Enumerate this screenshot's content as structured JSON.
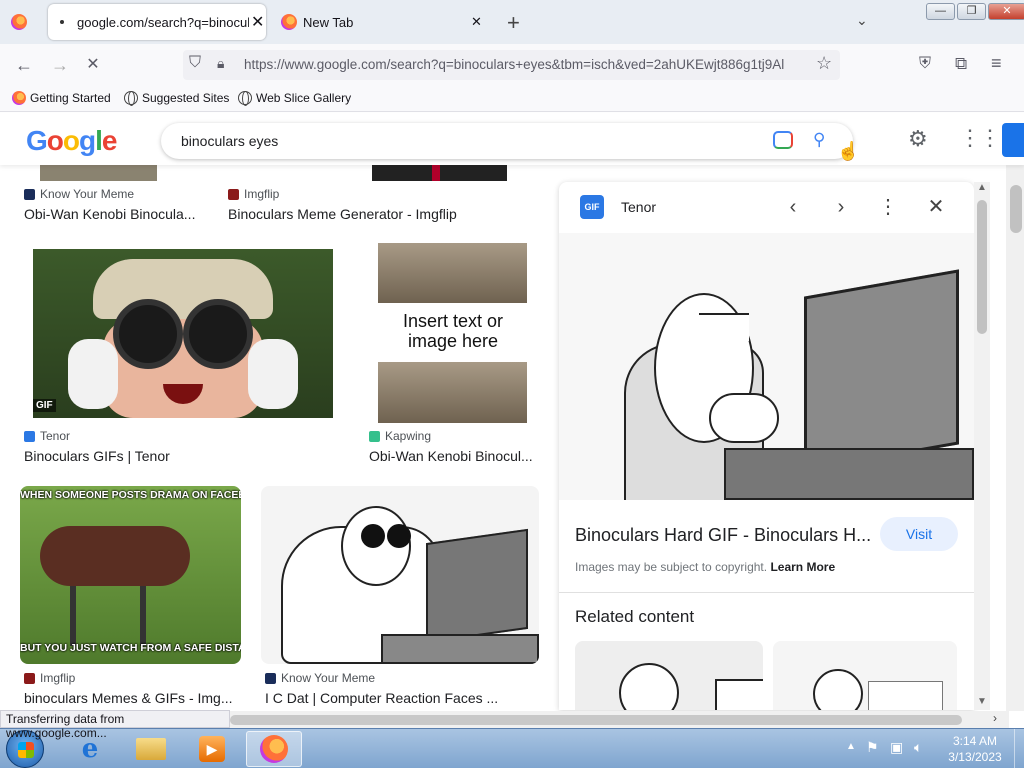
{
  "browser": {
    "tabs": [
      {
        "label": "google.com/search?q=binocula",
        "active": true
      },
      {
        "label": "New Tab",
        "active": false
      }
    ],
    "url": "https://www.google.com/search?q=binoculars+eyes&tbm=isch&ved=2ahUKEwjt886g1tj9Al",
    "bookmarks": [
      "Getting Started",
      "Suggested Sites",
      "Web Slice Gallery"
    ]
  },
  "google": {
    "logo": "Google",
    "query": "binoculars eyes"
  },
  "results": {
    "top_row": [
      {
        "source": "Know Your Meme",
        "title": "Obi-Wan Kenobi Binocula..."
      },
      {
        "source": "Imgflip",
        "title": "Binoculars Meme Generator - Imgflip"
      }
    ],
    "mid_row": [
      {
        "source": "Tenor",
        "title": "Binoculars GIFs | Tenor",
        "badge": "GIF"
      },
      {
        "source": "Kapwing",
        "title": "Obi-Wan Kenobi Binocul...",
        "overlay_text": "Insert text or image here"
      }
    ],
    "bottom_row": [
      {
        "source": "Imgflip",
        "title": "binoculars Memes & GIFs - Img...",
        "caption_top": "WHEN SOMEONE POSTS DRAMA ON FACEBOOK",
        "caption_bottom": "BUT YOU JUST WATCH FROM A SAFE DISTANCE"
      },
      {
        "source": "Know Your Meme",
        "title": "I C Dat | Computer Reaction Faces ..."
      }
    ]
  },
  "panel": {
    "source": "Tenor",
    "source_badge": "GIF",
    "title": "Binoculars Hard GIF - Binoculars H...",
    "visit_label": "Visit",
    "copyright": "Images may be subject to copyright.",
    "learn_more": "Learn More",
    "related_heading": "Related content"
  },
  "status": {
    "text": "Transferring data from www.google.com..."
  },
  "taskbar": {
    "time": "3:14 AM",
    "date": "3/13/2023"
  }
}
